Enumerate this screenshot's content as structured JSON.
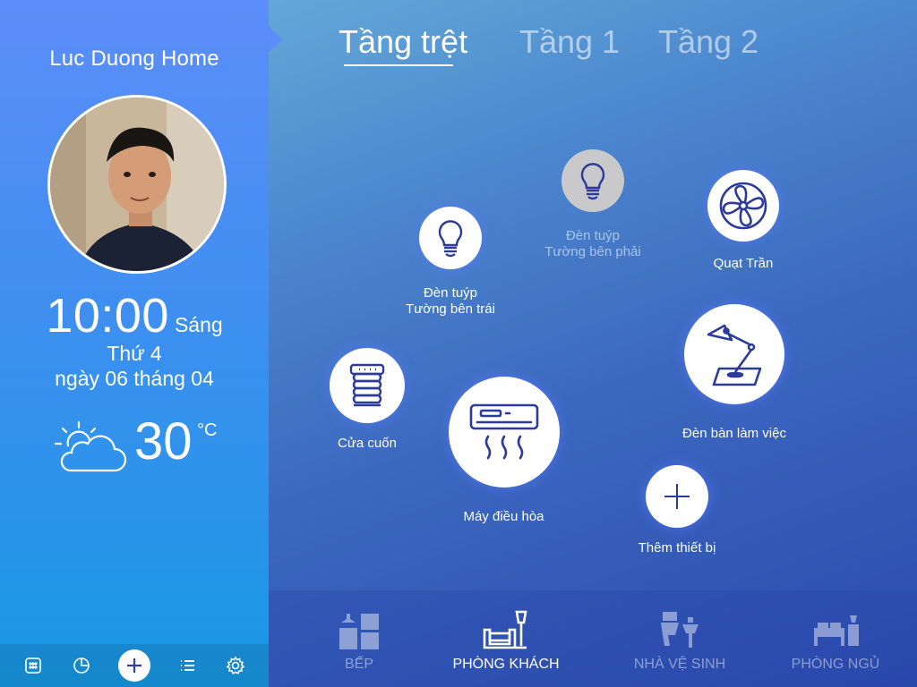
{
  "sidebar": {
    "home_title": "Luc Duong Home",
    "time": "10:00",
    "ampm": "Sáng",
    "day": "Thứ 4",
    "date": "ngày 06 tháng 04",
    "temperature": "30",
    "temperature_unit": "°C",
    "weather_icon": "partly-cloudy-icon",
    "bottom_icons": [
      "calculator-icon",
      "pie-chart-icon",
      "add-icon",
      "list-icon",
      "settings-icon"
    ]
  },
  "floors": {
    "tabs": [
      {
        "label": "Tầng trệt",
        "active": true
      },
      {
        "label": "Tầng 1",
        "active": false
      },
      {
        "label": "Tầng 2",
        "active": false
      }
    ]
  },
  "devices": [
    {
      "label1": "Đèn tuýp",
      "label2": "Tường bên trái",
      "icon": "bulb-icon",
      "on": true
    },
    {
      "label1": "Đèn tuýp",
      "label2": "Tường bên phải",
      "icon": "bulb-icon",
      "on": false
    },
    {
      "label1": "Quạt Trần",
      "label2": "",
      "icon": "fan-icon",
      "on": true
    },
    {
      "label1": "Đèn bàn làm việc",
      "label2": "",
      "icon": "desk-lamp-icon",
      "on": true
    },
    {
      "label1": "Cửa cuốn",
      "label2": "",
      "icon": "roller-door-icon",
      "on": true
    },
    {
      "label1": "Máy điều hòa",
      "label2": "",
      "icon": "air-conditioner-icon",
      "on": true
    },
    {
      "label1": "Thêm thiết bị",
      "label2": "",
      "icon": "add-icon",
      "on": true
    }
  ],
  "rooms": [
    {
      "label": "BẾP",
      "icon": "kitchen-icon",
      "active": false
    },
    {
      "label": "PHÒNG KHÁCH",
      "icon": "living-room-icon",
      "active": true
    },
    {
      "label": "NHÀ VỆ SINH",
      "icon": "bathroom-icon",
      "active": false
    },
    {
      "label": "PHÒNG NGỦ",
      "icon": "bedroom-icon",
      "active": false
    }
  ],
  "colors": {
    "accent": "#2e3fa8",
    "icon_stroke": "#2b3a9c"
  }
}
